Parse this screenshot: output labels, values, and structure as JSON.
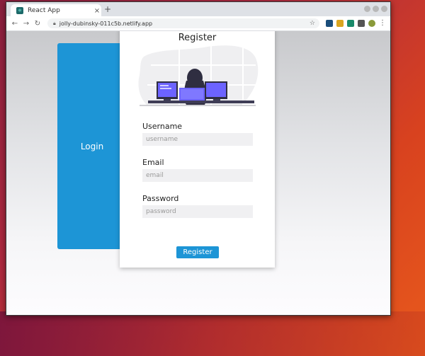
{
  "browser": {
    "tab_title": "React App",
    "tab_close": "×",
    "new_tab": "+",
    "url": "jolly-dubinsky-011c5b.netlify.app",
    "back": "←",
    "forward": "→",
    "reload": "↻",
    "star": "☆"
  },
  "page": {
    "login_label": "Login",
    "register_title": "Register",
    "fields": [
      {
        "label": "Username",
        "placeholder": "username",
        "value": ""
      },
      {
        "label": "Email",
        "placeholder": "email",
        "value": ""
      },
      {
        "label": "Password",
        "placeholder": "password",
        "value": ""
      }
    ],
    "register_button": "Register"
  },
  "colors": {
    "accent": "#1d95d6",
    "illustration_shirt": "#f45d7a",
    "illustration_screen": "#6c63ff",
    "illustration_dark": "#2f2e41"
  }
}
